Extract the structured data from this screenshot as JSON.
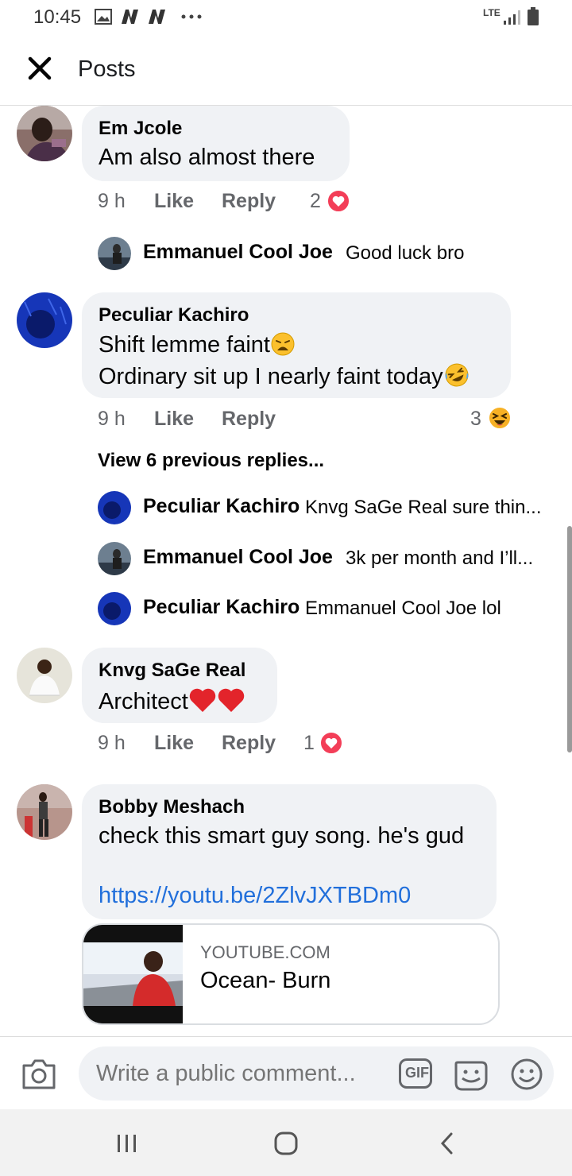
{
  "status_bar": {
    "time": "10:45",
    "network": "LTE"
  },
  "header": {
    "title": "Posts"
  },
  "comments": [
    {
      "name": "Em Jcole",
      "text": "Am also almost there",
      "time": "9 h",
      "like": "Like",
      "reply": "Reply",
      "reaction_count": "2",
      "reaction": "love",
      "replies": [
        {
          "name": "Emmanuel Cool Joe",
          "text": "Good luck bro"
        }
      ]
    },
    {
      "name": "Peculiar Kachiro",
      "text_line1": "Shift lemme faint",
      "text_line2": "Ordinary sit up I nearly faint today",
      "time": "9 h",
      "like": "Like",
      "reply": "Reply",
      "reaction_count": "3",
      "reaction": "haha",
      "view_previous": "View 6 previous replies...",
      "replies": [
        {
          "name": "Peculiar Kachiro",
          "text": "Knvg SaGe Real sure thin..."
        },
        {
          "name": "Emmanuel Cool Joe",
          "text": "3k per month and I’ll..."
        },
        {
          "name": "Peculiar Kachiro",
          "text": "Emmanuel Cool Joe lol"
        }
      ]
    },
    {
      "name": "Knvg SaGe Real",
      "text": "Architect",
      "time": "9 h",
      "like": "Like",
      "reply": "Reply",
      "reaction_count": "1",
      "reaction": "love"
    },
    {
      "name": "Bobby Meshach",
      "text": "check this smart guy song. he's gud",
      "link": "https://youtu.be/2ZlvJXTBDm0",
      "link_card": {
        "domain": "YOUTUBE.COM",
        "title": "Ocean- Burn"
      }
    }
  ],
  "composer": {
    "placeholder": "Write a public comment...",
    "gif_label": "GIF"
  },
  "colors": {
    "bubble": "#f0f2f5",
    "link": "#216fdb",
    "love": "#f33e58",
    "haha": "#f7b125",
    "meta": "#65676b"
  }
}
